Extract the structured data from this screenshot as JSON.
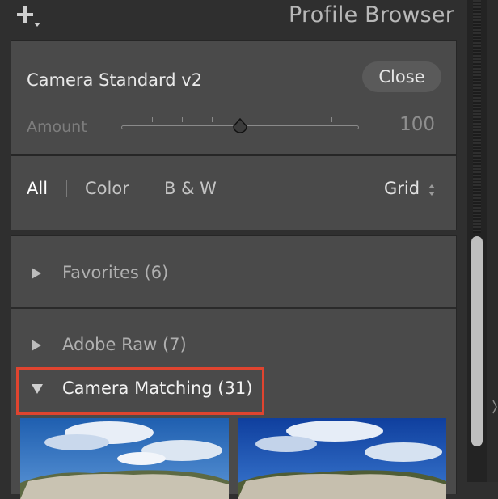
{
  "header": {
    "title": "Profile Browser",
    "add_icon": "plus-dropdown-icon"
  },
  "profile": {
    "name": "Camera Standard v2",
    "close_label": "Close",
    "amount_label": "Amount",
    "amount_value": "100",
    "amount_fraction": 0.5
  },
  "filters": {
    "tabs": [
      {
        "label": "All",
        "active": true
      },
      {
        "label": "Color",
        "active": false
      },
      {
        "label": "B & W",
        "active": false
      }
    ],
    "view_label": "Grid",
    "view_icon": "up-down-chevron-icon"
  },
  "groups": [
    {
      "label": "Favorites (6)",
      "expanded": false,
      "icon": "disclosure-right-icon"
    },
    {
      "label": "Adobe Raw (7)",
      "expanded": false,
      "icon": "disclosure-right-icon"
    },
    {
      "label": "Camera Matching (31)",
      "expanded": true,
      "icon": "disclosure-down-icon"
    }
  ],
  "colors": {
    "highlight": "#e0442f",
    "panel": "#4a4a4a",
    "background": "#2f2f2f"
  }
}
